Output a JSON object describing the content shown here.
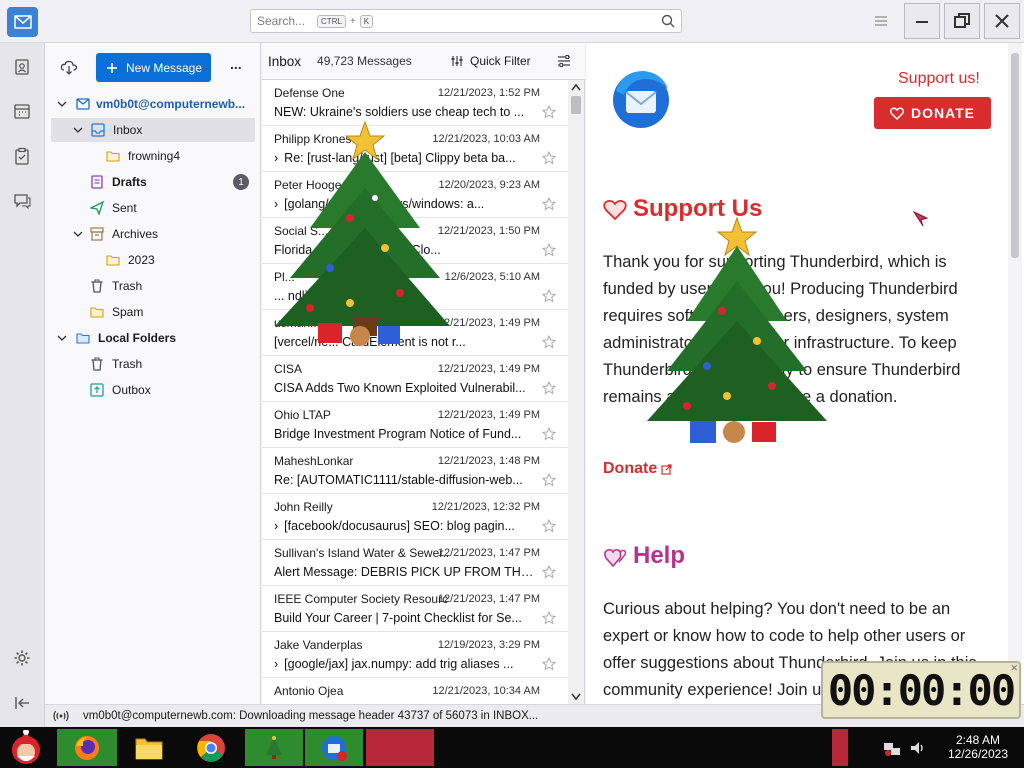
{
  "titlebar": {
    "search_placeholder": "Search...",
    "shortcut_ctrl": "CTRL",
    "shortcut_plus": "+",
    "shortcut_key": "K"
  },
  "folder_pane": {
    "new_message_label": "New Message",
    "more_label": "...",
    "account": "vm0b0t@computernewb...",
    "folders": [
      {
        "label": "Inbox",
        "icon": "inbox-icon",
        "indent": 1
      },
      {
        "label": "frowning4",
        "icon": "folder-icon",
        "indent": 2
      },
      {
        "label": "Drafts",
        "icon": "drafts-icon",
        "indent": 1,
        "count": "1"
      },
      {
        "label": "Sent",
        "icon": "sent-icon",
        "indent": 1
      },
      {
        "label": "Archives",
        "icon": "archive-icon",
        "indent": 1
      },
      {
        "label": "2023",
        "icon": "folder-icon",
        "indent": 2
      },
      {
        "label": "Trash",
        "icon": "trash-icon",
        "indent": 1
      },
      {
        "label": "Spam",
        "icon": "folder-icon",
        "indent": 1
      },
      {
        "label": "Local Folders",
        "icon": "local-folders-icon",
        "indent": 0
      },
      {
        "label": "Trash",
        "icon": "trash-icon",
        "indent": 1
      },
      {
        "label": "Outbox",
        "icon": "outbox-icon",
        "indent": 1
      }
    ]
  },
  "message_list": {
    "folder": "Inbox",
    "count": "49,723 Messages",
    "quick_filter": "Quick Filter",
    "messages": [
      {
        "sender": "Defense One",
        "date": "12/21/2023, 1:52 PM",
        "subject": "NEW: Ukraine's soldiers use cheap tech to ..."
      },
      {
        "sender": "Philipp Krones",
        "date": "12/21/2023, 10:03 AM",
        "subject": "Re: [rust-lang/rust] [beta] Clippy beta ba..."
      },
      {
        "sender": "Peter Hooge",
        "date": "12/20/2023, 9:23 AM",
        "subject": "[golang/go] ... al: x/sys/windows: a..."
      },
      {
        "sender": "Social S...",
        "date": "12/21/2023, 1:50 PM",
        "subject": "Florida ... Administration Clo..."
      },
      {
        "sender": "Pl...",
        "date": "12/6/2023, 5:10 AM",
        "subject": "... ndling of TP..."
      },
      {
        "sender": "usman...",
        "date": "12/21/2023, 1:49 PM",
        "subject": "[vercel/ne... CardElement is not r..."
      },
      {
        "sender": "CISA",
        "date": "12/21/2023, 1:49 PM",
        "subject": "CISA Adds Two Known Exploited Vulnerabil..."
      },
      {
        "sender": "Ohio LTAP",
        "date": "12/21/2023, 1:49 PM",
        "subject": "Bridge Investment Program Notice of Fund..."
      },
      {
        "sender": "MaheshLonkar",
        "date": "12/21/2023, 1:48 PM",
        "subject": "Re: [AUTOMATIC1111/stable-diffusion-web..."
      },
      {
        "sender": "John Reilly",
        "date": "12/21/2023, 12:32 PM",
        "subject": "[facebook/docusaurus] SEO: blog pagin..."
      },
      {
        "sender": "Sullivan's Island Water & Sewer...",
        "date": "12/21/2023, 1:47 PM",
        "subject": "Alert Message: DEBRIS PICK UP FROM THE..."
      },
      {
        "sender": "IEEE Computer Society Resourc...",
        "date": "12/21/2023, 1:47 PM",
        "subject": "Build Your Career | 7-point Checklist for Se..."
      },
      {
        "sender": "Jake Vanderplas",
        "date": "12/19/2023, 3:29 PM",
        "subject": "[google/jax] jax.numpy: add trig aliases ..."
      },
      {
        "sender": "Antonio Ojea",
        "date": "12/21/2023, 10:34 AM",
        "subject": ""
      }
    ]
  },
  "reading_pane": {
    "support_link": "Support us!",
    "donate_button": "DONATE",
    "support_title": "Support Us",
    "support_text": "Thank you for supporting Thunderbird, which is funded by users like you! Producing Thunderbird requires software engineers, designers, system administrators and server infrastructure. To keep Thunderbird, the best way to ensure Thunderbird remains available is to make a donation.",
    "donate_link": "Donate",
    "help_title": "Help",
    "help_text": "Curious about helping? You don't need to be an expert or know how to code to help other users or offer suggestions about Thunderbird. Join us in this community experience! Join us in this c"
  },
  "statusbar": {
    "text": "vm0b0t@computernewb.com: Downloading message header 43737 of 56073 in INBOX..."
  },
  "timer": {
    "value": "00:00:00"
  },
  "taskbar": {
    "time": "2:48 AM",
    "date": "12/26/2023"
  },
  "colors": {
    "accent": "#0a6fd8",
    "donate": "#d92c2c",
    "help": "#b7328f"
  }
}
